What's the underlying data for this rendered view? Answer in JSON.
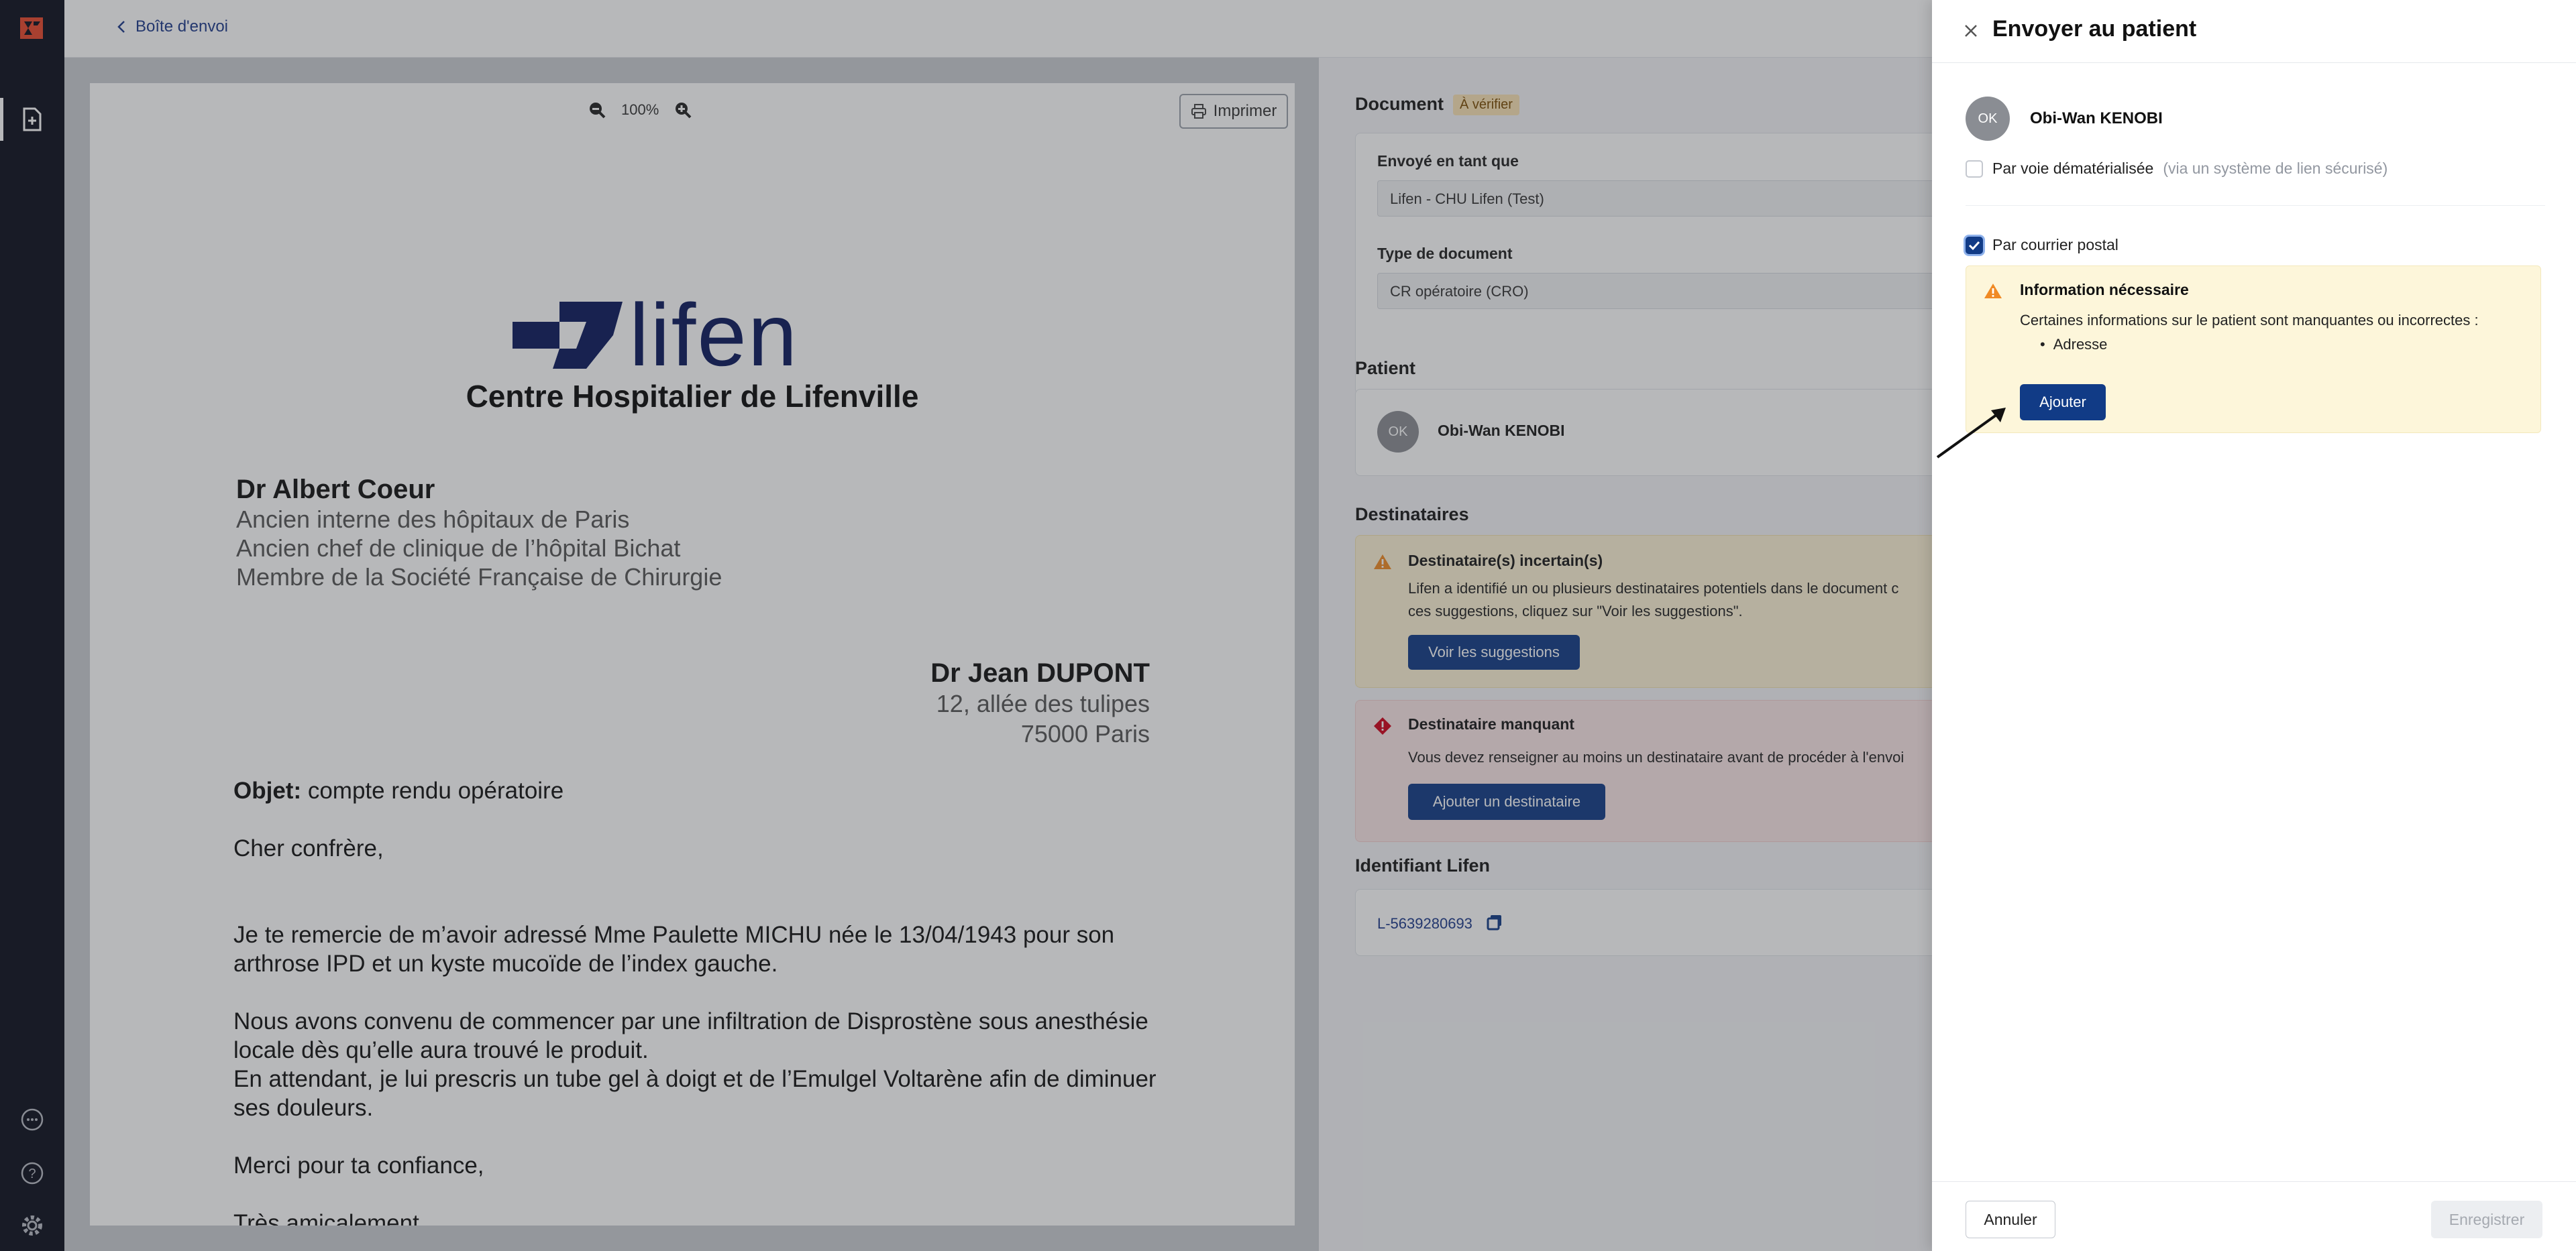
{
  "nav": {
    "back_label": "Boîte d'envoi"
  },
  "preview": {
    "zoom_level": "100%",
    "print_label": "Imprimer",
    "letter": {
      "logo_word": "lifen",
      "hospital": "Centre Hospitalier de Lifenville",
      "author_name": "Dr Albert Coeur",
      "author_lines": [
        "Ancien interne des hôpitaux de Paris",
        "Ancien chef de clinique de l’hôpital Bichat",
        "Membre de la Société Française de Chirurgie"
      ],
      "recipient_name": "Dr Jean DUPONT",
      "recipient_lines": [
        "12, allée des tulipes",
        "75000 Paris"
      ],
      "subject_label": "Objet:",
      "subject_text": " compte rendu opératoire",
      "greeting": "Cher confrère,",
      "paragraph1": "Je te remercie de m’avoir adressé Mme Paulette MICHU née le 13/04/1943 pour son arthrose IPD et un kyste mucoïde de l’index gauche.",
      "paragraph2a": "Nous avons convenu de commencer par une infiltration de Disprostène sous anesthésie locale dès qu’elle aura trouvé le produit.",
      "paragraph2b": "En attendant, je lui prescris un tube gel à doigt et de l’Emulgel Voltarène afin de diminuer ses douleurs.",
      "thanks": "Merci pour ta confiance,",
      "closing": "Très amicalement"
    }
  },
  "form": {
    "document_title": "Document",
    "document_badge": "À vérifier",
    "sent_as_label": "Envoyé en tant que",
    "sent_as_value": "Lifen - CHU Lifen (Test)",
    "doc_type_label": "Type de document",
    "doc_type_value": "CR opératoire (CRO)",
    "patient_title": "Patient",
    "patient_initials": "OK",
    "patient_name": "Obi-Wan KENOBI",
    "recipients_title": "Destinataires",
    "warn_title": "Destinataire(s) incertain(s)",
    "warn_text_1": "Lifen a identifié un ou plusieurs destinataires potentiels dans le document c",
    "warn_text_2": "ces suggestions, cliquez sur \"Voir les suggestions\".",
    "warn_button": "Voir les suggestions",
    "err_title": "Destinataire manquant",
    "err_text": "Vous devez renseigner au moins un destinataire avant de procéder à l'envoi",
    "err_button": "Ajouter un destinataire",
    "id_title": "Identifiant Lifen",
    "id_value": "L-5639280693"
  },
  "drawer": {
    "title": "Envoyer au patient",
    "patient_initials": "OK",
    "patient_name": "Obi-Wan KENOBI",
    "option_digital_label": "Par voie dématérialisée",
    "option_digital_hint": "(via un système de lien sécurisé)",
    "option_postal_label": "Par courrier postal",
    "info_title": "Information nécessaire",
    "info_text": "Certaines informations sur le patient sont manquantes ou incorrectes :",
    "info_bullet": "Adresse",
    "add_button": "Ajouter",
    "cancel_button": "Annuler",
    "save_button": "Enregistrer"
  },
  "colors": {
    "primary": "#113b86",
    "rail": "#0b0f1c",
    "logo_red": "#e8472b",
    "warning": "#f08a24",
    "error": "#d0021b"
  },
  "icons": [
    "lifen-logo-icon",
    "document-add-icon",
    "chat-icon",
    "help-icon",
    "settings-icon",
    "chevron-left-icon",
    "zoom-out-icon",
    "zoom-in-icon",
    "printer-icon",
    "warning-icon",
    "error-icon",
    "copy-icon",
    "close-icon",
    "check-icon",
    "arrow-pointer-icon"
  ]
}
